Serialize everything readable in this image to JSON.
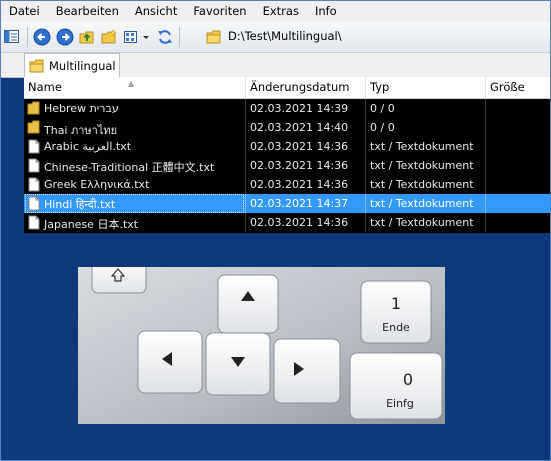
{
  "menu": [
    "Datei",
    "Bearbeiten",
    "Ansicht",
    "Favoriten",
    "Extras",
    "Info"
  ],
  "address": "D:\\Test\\Multilingual\\",
  "tab_label": "Multilingual",
  "columns": {
    "name": "Name",
    "date": "Änderungsdatum",
    "type": "Typ",
    "size": "Größe"
  },
  "files": [
    {
      "name": "Hebrew   עברית",
      "date": "02.03.2021 14:39",
      "type": "0 / 0",
      "kind": "folder"
    },
    {
      "name": "Thai   ภาษาไทย",
      "date": "02.03.2021 14:40",
      "type": "0 / 0",
      "kind": "folder"
    },
    {
      "name": "Arabic  العربية.txt",
      "date": "02.03.2021 14:36",
      "type": "txt / Textdokument",
      "kind": "file"
    },
    {
      "name": "Chinese-Traditional  正體中文.txt",
      "date": "02.03.2021 14:36",
      "type": "txt / Textdokument",
      "kind": "file"
    },
    {
      "name": "Greek  Ελληνικά.txt",
      "date": "02.03.2021 14:36",
      "type": "txt / Textdokument",
      "kind": "file"
    },
    {
      "name": "Hindi  हिन्दी.txt",
      "date": "02.03.2021 14:37",
      "type": "txt / Textdokument",
      "kind": "file",
      "selected": true
    },
    {
      "name": "Japanese  日本.txt",
      "date": "02.03.2021 14:36",
      "type": "txt / Textdokument",
      "kind": "file"
    }
  ],
  "keys": {
    "one": "1",
    "ende": "Ende",
    "zero": "0",
    "einfg": "Einfg"
  }
}
